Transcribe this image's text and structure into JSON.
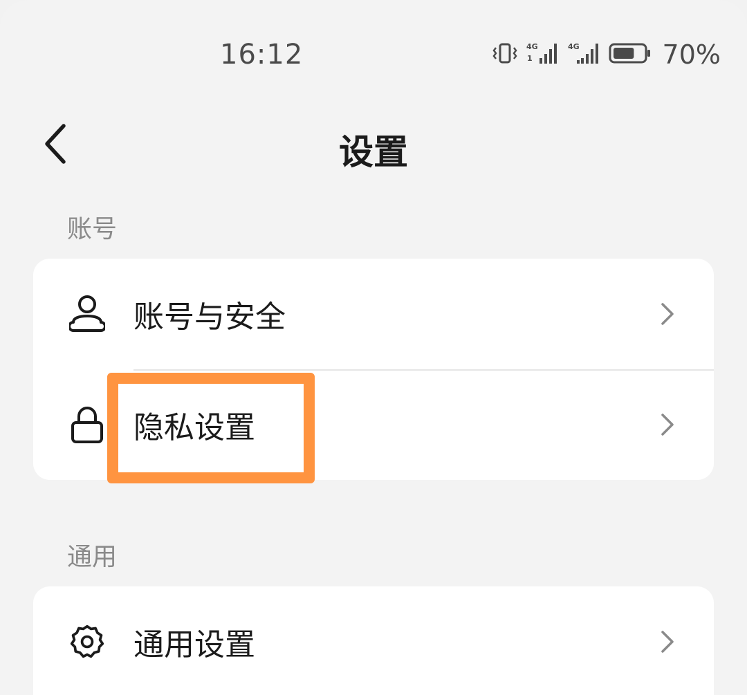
{
  "status_bar": {
    "time": "16:12",
    "battery_percent": "70%",
    "battery_level": 0.7,
    "icons": [
      "vibrate-icon",
      "signal-4g-sim1-icon",
      "signal-4g-sim2-icon",
      "battery-icon"
    ]
  },
  "header": {
    "title": "设置",
    "back_icon": "back-arrow-icon"
  },
  "sections": [
    {
      "label": "账号",
      "items": [
        {
          "label": "账号与安全",
          "icon": "user-icon"
        },
        {
          "label": "隐私设置",
          "icon": "lock-icon"
        }
      ]
    },
    {
      "label": "通用",
      "items": [
        {
          "label": "通用设置",
          "icon": "gear-icon"
        }
      ]
    }
  ],
  "colors": {
    "background": "#f3f3f3",
    "card": "#ffffff",
    "text_primary": "#1b1b1b",
    "text_secondary": "#8a8a8a",
    "highlight": "#ff9440"
  }
}
